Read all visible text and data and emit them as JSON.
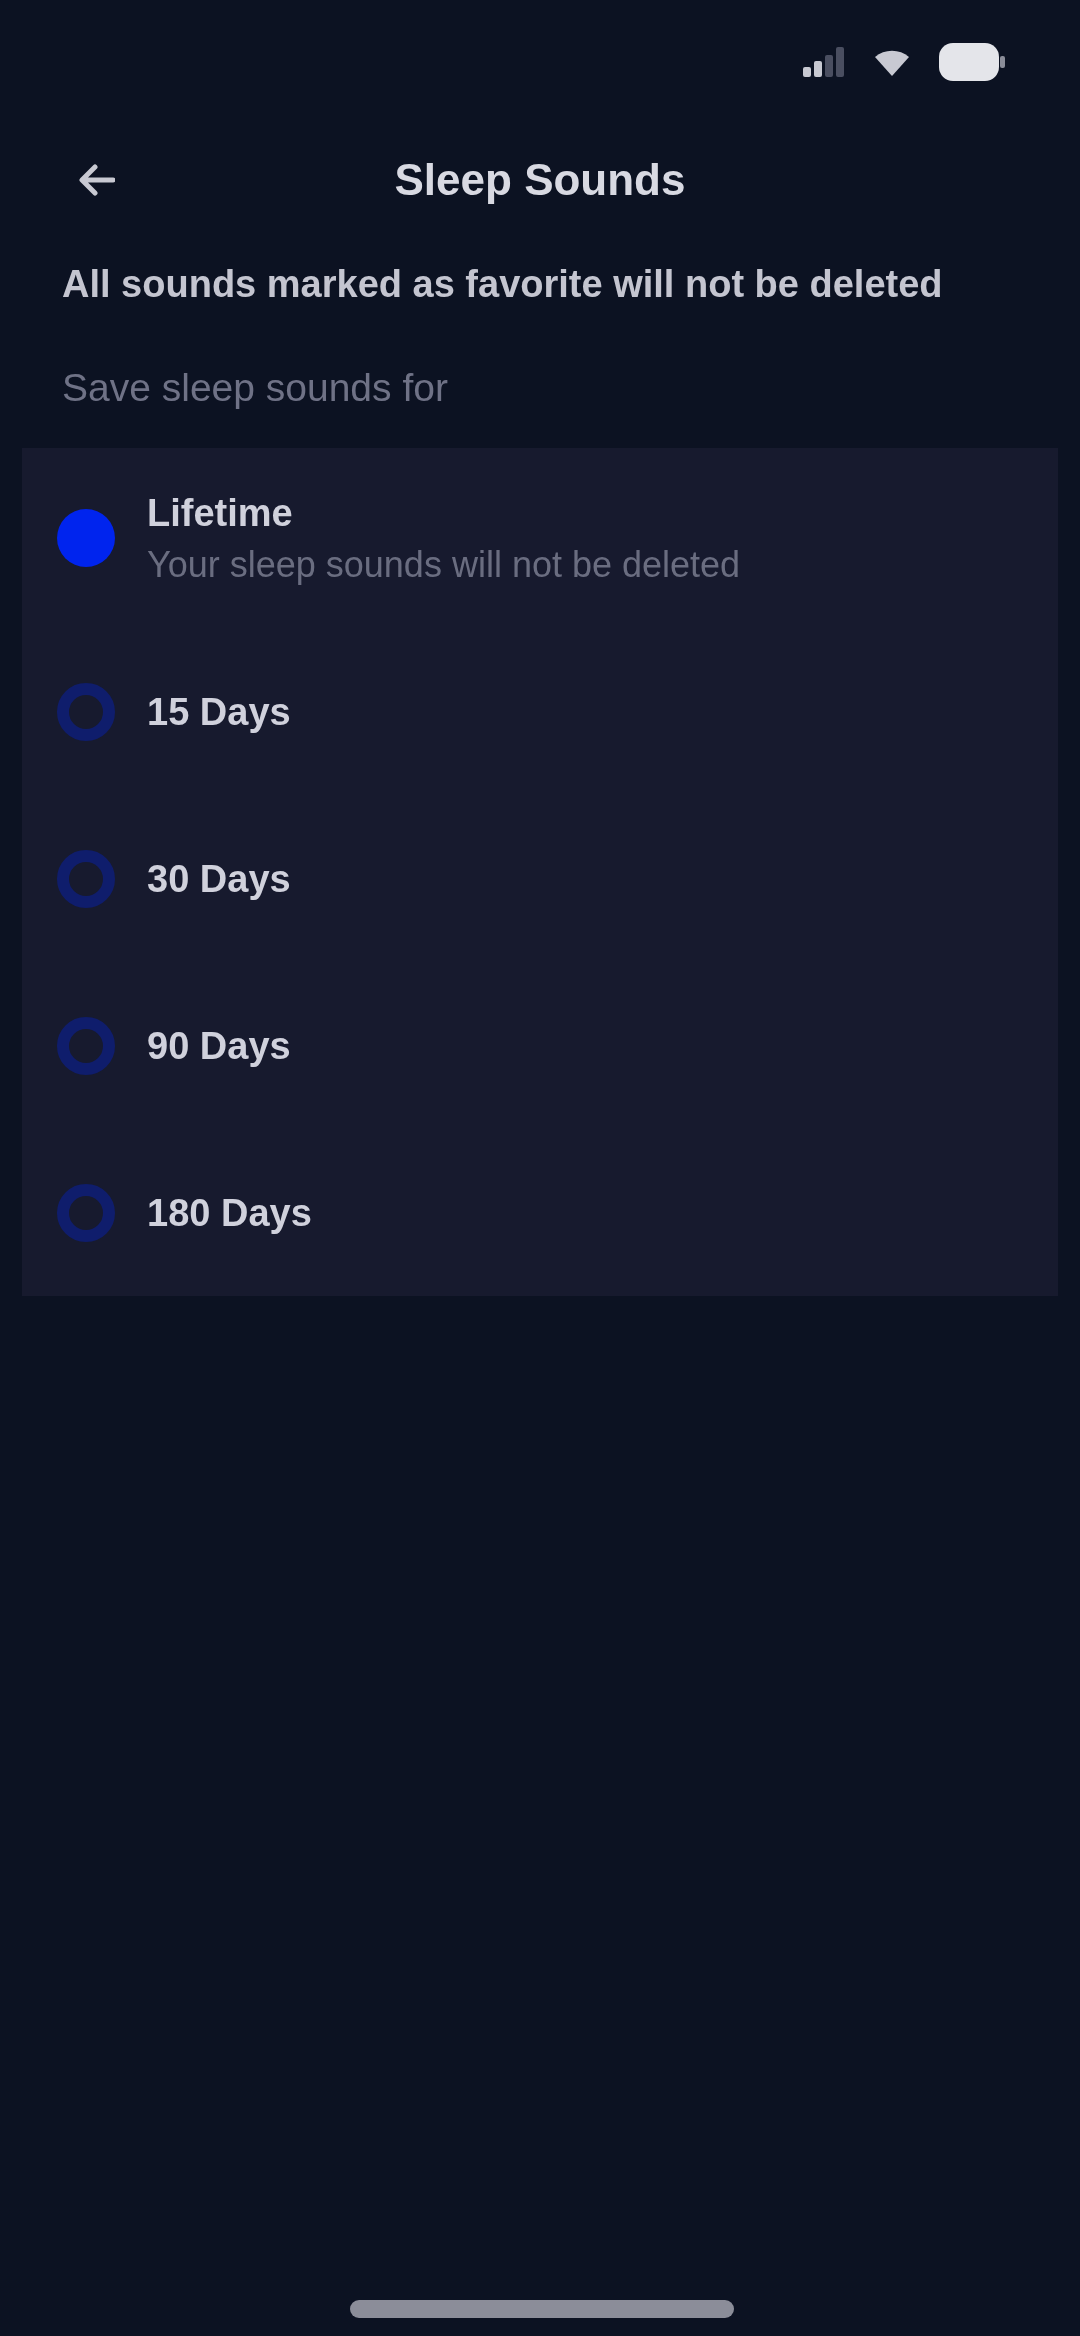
{
  "header": {
    "title": "Sleep Sounds"
  },
  "note": "All sounds marked as favorite will not be deleted",
  "section_label": "Save sleep sounds for",
  "options": [
    {
      "label": "Lifetime",
      "description": "Your sleep sounds will not be deleted",
      "selected": true
    },
    {
      "label": "15 Days",
      "selected": false
    },
    {
      "label": "30 Days",
      "selected": false
    },
    {
      "label": "90 Days",
      "selected": false
    },
    {
      "label": "180 Days",
      "selected": false
    }
  ]
}
